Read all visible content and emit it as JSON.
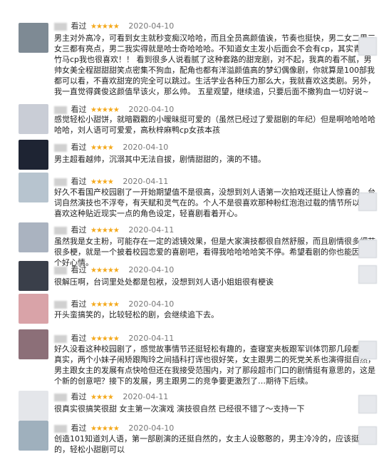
{
  "reviews": [
    {
      "prefix": "看过",
      "stars": "★★★★★",
      "date": "2020-04-10",
      "text": "男主对外高冷，可看到女主就秒变痴汉哈哈，而且全员高颜值诶，节奏也挺快，男二女二男三女三都有亮点，男二我实得就是哈士奇哈哈哈。不知道女主发小后面会不会有cp，其实青梅竹马cp我也很喜欢！！ 看到很多人说看腻了这种套路的甜宠剧，对不起，我真的看不腻，男帅女美全程甜甜甜笑点密集不狗血，配角也都有洋溢颜值高的梦幻偶像剧，你就算是100部我都可以看，不喜欢甜宠的完全可以跳过。生活学业各种压力那么大，我就喜欢这类剧。另外，我一直觉得龚俊这颜值早该火，那么帅。 五星观望，继续追，只要后面不撒狗血一切好说~",
      "avatar": "#7e8a94"
    },
    {
      "prefix": "看过",
      "stars": "★★★★★",
      "date": "2020-04-10",
      "text": "感觉轻松小甜饼，就暗戳戳的小暧昧挺可爱的（虽然已经过了爱甜剧的年纪）但是啊哈哈哈哈哈哈，刘人语可可爱爱，高秋梓麻鸭cp女孩本孩",
      "avatar": "#c9cdd6"
    },
    {
      "prefix": "看过",
      "stars": "★★★★",
      "date": "2020-04-10",
      "text": "男主超看越帅，沉溺其中无法自拔，剧情甜甜的，演的不错。",
      "avatar": "#1e2433"
    },
    {
      "prefix": "看过",
      "stars": "★★★★",
      "date": "2020-04-11",
      "text": "好久不看国产校园剧了一开始期望值不是很高，没想到刘人语第一次拍戏还挺让人惊喜的，台词自然演技也不浮夸，有天赋和灵气在的。个人不是很喜欢那种粉红泡泡过载的情节所以还蛮喜欢这种贴近现实一点的角色设定，轻喜剧看着开心。",
      "avatar": "#b7c4cf"
    },
    {
      "prefix": "看过",
      "stars": "★★★★★",
      "date": "2020-04-11",
      "text": "虽然我是女主粉，可能存在一定的滤镜效果，但是大家演技都很自然舒服，而且剧情很多细节很多梗，就是一个披着校园恋爱的喜剧吧，看得我哈哈哈哈笑不停。希望看剧的你也能因此有个好心情。",
      "avatar": "#aab3c0"
    },
    {
      "prefix": "看过",
      "stars": "★★★★★",
      "date": "2020-04-10",
      "text": "很解压啊，台词里处处都是包袱，没想到刘人语小姐姐很有梗诶",
      "avatar": "#3a3f4a"
    },
    {
      "prefix": "看过",
      "stars": "★★★★★",
      "date": "2020-04-10",
      "text": "开头蛮搞笑的，比较轻松的剧，会继续追下去。",
      "avatar": "#d9a3a8"
    },
    {
      "prefix": "看过",
      "stars": "★★★★★",
      "date": "2020-04-11",
      "text": "好久没看这种校园剧了，感觉故事情节还挺轻松有趣的，查寝室夹板跟军训体罚那几段都非常真实，两个小妹子闹矫跟陶玲之间插科打诨也很好笑，女主跟男二的死党关系也演得挺自然，男主跟女主的发展有点快哈但还在我接受范围内，对了那段超市门口的剧情挺有意思的，这是个新的创意吧？接下的发展，男主跟男二的竞争要更激烈了…期待下后续。",
      "avatar": "#8c6f78"
    },
    {
      "prefix": "看过",
      "stars": "★★★★",
      "date": "2020-04-11",
      "text": "很真实很搞笑很甜 女主第一次演戏 演技很自然 已经很不错了～支持一下",
      "avatar": "#e4e6ea"
    },
    {
      "prefix": "看过",
      "stars": "★★★★★",
      "date": "2020-04-10",
      "text": "创造101知道刘人语，第一部剧演的还挺自然的，女主人设憨憨的，男主冷冷的，应该挺搞笑的，轻松小甜剧可以",
      "avatar": "#9fb0bd"
    }
  ]
}
